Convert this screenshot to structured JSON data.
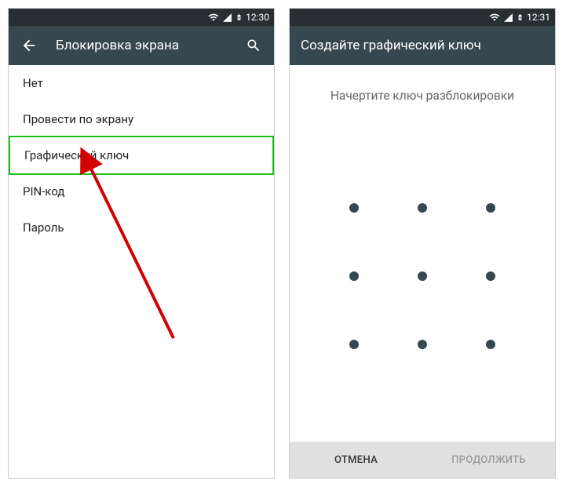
{
  "left": {
    "status": {
      "time": "12:30"
    },
    "appbar": {
      "title": "Блокировка экрана"
    },
    "items": [
      {
        "label": "Нет",
        "highlight": false
      },
      {
        "label": "Провести по экрану",
        "highlight": false
      },
      {
        "label": "Графический ключ",
        "highlight": true
      },
      {
        "label": "PIN-код",
        "highlight": false
      },
      {
        "label": "Пароль",
        "highlight": false
      }
    ]
  },
  "right": {
    "status": {
      "time": "12:31"
    },
    "appbar": {
      "title": "Создайте графический ключ"
    },
    "instruction": "Начертите ключ разблокировки",
    "buttons": {
      "cancel": "ОТМЕНА",
      "continue": "ПРОДОЛЖИТЬ"
    }
  }
}
